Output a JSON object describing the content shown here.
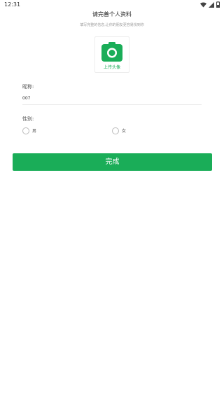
{
  "status_bar": {
    "time": "12:31",
    "icons": [
      "wifi-icon",
      "signal-icon",
      "battery-icon"
    ]
  },
  "header": {
    "title": "请完善个人资料",
    "subtitle": "填写完整的信息,让你的朋友更容易找到你"
  },
  "avatar": {
    "upload_label": "上传头像",
    "icon": "camera-icon"
  },
  "nickname": {
    "label": "昵称:",
    "value": "007"
  },
  "gender": {
    "label": "性别:",
    "options": [
      "男",
      "女"
    ],
    "selected": null
  },
  "done_button": {
    "label": "完成"
  },
  "colors": {
    "accent": "#1aad58",
    "text": "#333333",
    "muted": "#9a9a9a",
    "divider": "#eaeaea"
  }
}
